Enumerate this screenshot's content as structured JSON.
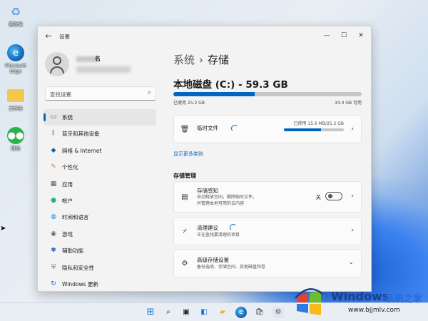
{
  "desktop": {
    "icons": [
      {
        "label": "回收站",
        "icon": "recycle-bin-icon"
      },
      {
        "label": "Microsoft Edge",
        "icon": "edge-icon"
      },
      {
        "label": "文件夹",
        "icon": "folder-icon"
      },
      {
        "label": "微信",
        "icon": "wechat-icon"
      }
    ]
  },
  "window": {
    "title": "设置",
    "back_icon": "back-arrow-icon",
    "controls": [
      "minimize-icon",
      "maximize-icon",
      "close-icon"
    ]
  },
  "sidebar": {
    "user_name": "名",
    "search_placeholder": "查找设置",
    "items": [
      {
        "label": "系统",
        "icon": "monitor-icon",
        "active": true
      },
      {
        "label": "蓝牙和其他设备",
        "icon": "bluetooth-icon"
      },
      {
        "label": "网络 & Internet",
        "icon": "wifi-icon"
      },
      {
        "label": "个性化",
        "icon": "brush-icon"
      },
      {
        "label": "应用",
        "icon": "apps-icon"
      },
      {
        "label": "帐户",
        "icon": "account-icon"
      },
      {
        "label": "时间和语言",
        "icon": "globe-clock-icon"
      },
      {
        "label": "游戏",
        "icon": "gamepad-icon"
      },
      {
        "label": "辅助功能",
        "icon": "accessibility-icon"
      },
      {
        "label": "隐私和安全性",
        "icon": "shield-icon"
      },
      {
        "label": "Windows 更新",
        "icon": "update-icon"
      }
    ]
  },
  "main": {
    "breadcrumb": {
      "parent": "系统",
      "separator": "›",
      "current": "存储"
    },
    "disk": {
      "title": "本地磁盘 (C:) - 59.3 GB",
      "used_fraction": 0.43,
      "used_label": "已使用 25.2 GB",
      "available_label": "34.0 GB 可用"
    },
    "temp_files": {
      "label": "临时文件",
      "used_label": "已使用 15.6 MB/25.2 GB",
      "fraction": 0.62
    },
    "more_categories_link": "显示更多类别",
    "storage_mgmt": {
      "section_title": "存储管理",
      "storage_sense": {
        "title": "存储感知",
        "subtitle_line1": "自动释放空间，删除临时文件，",
        "subtitle_line2": "并管理本地可用的云内容",
        "toggle_label": "关",
        "toggle_on": false
      },
      "cleanup": {
        "title": "清理建议",
        "subtitle": "正在查找要清理的项目"
      },
      "advanced": {
        "title": "高级存储设置",
        "subtitle": "备份选项、存储空间、其他磁盘和卷"
      }
    }
  },
  "taskbar": {
    "icons": [
      "start-icon",
      "search-icon",
      "task-view-icon",
      "widgets-icon",
      "file-explorer-icon",
      "edge-icon",
      "store-icon",
      "settings-icon"
    ]
  },
  "watermark": {
    "word1": "Windows",
    "word2": "系统之家",
    "url": "www.bjjmlv.com"
  },
  "colors": {
    "accent": "#0067c0"
  }
}
